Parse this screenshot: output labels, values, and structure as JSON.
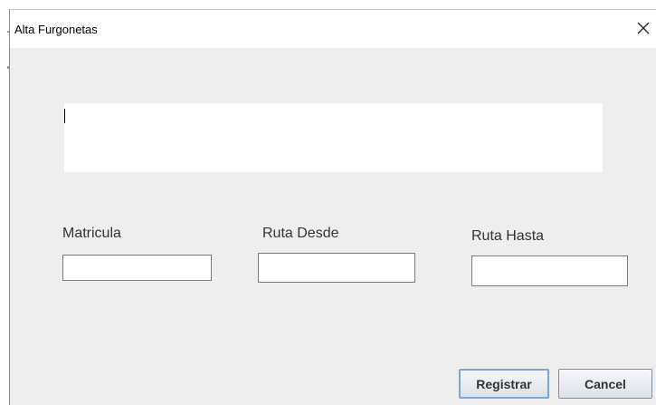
{
  "window": {
    "title": "Alta Furgonetas",
    "close_glyph": "✕"
  },
  "text_area": {
    "value": ""
  },
  "fields": [
    {
      "label": "Matricula",
      "value": ""
    },
    {
      "label": "Ruta Desde",
      "value": ""
    },
    {
      "label": "Ruta Hasta",
      "value": ""
    }
  ],
  "buttons": {
    "register": "Registrar",
    "cancel": "Cancel"
  },
  "icons": {
    "close": "close-icon"
  }
}
